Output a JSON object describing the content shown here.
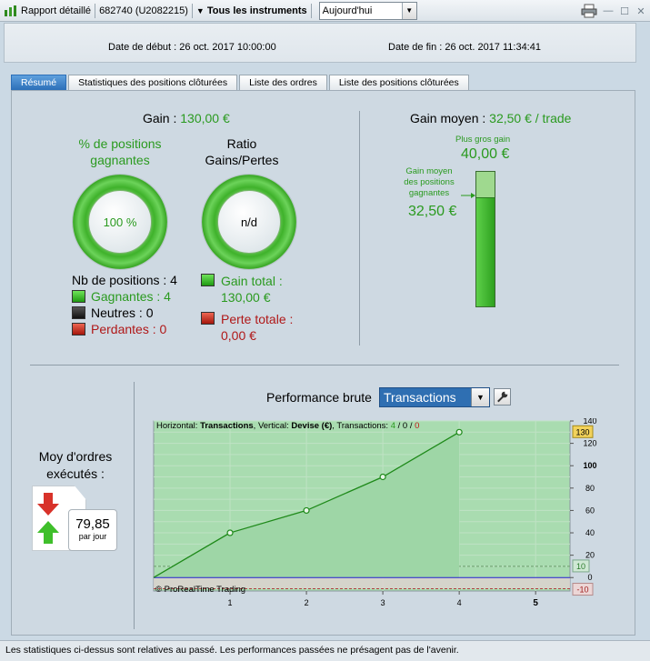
{
  "toolbar": {
    "report_label": "Rapport détaillé",
    "account": "682740 (U2082215)",
    "instruments_label": "Tous les instruments",
    "period_value": "Aujourd'hui"
  },
  "dates": {
    "start": "Date de début : 26 oct. 2017 10:00:00",
    "end": "Date de fin : 26 oct. 2017 11:34:41"
  },
  "tabs": [
    {
      "label": "Résumé",
      "active": true
    },
    {
      "label": "Statistiques des positions clôturées",
      "active": false
    },
    {
      "label": "Liste des ordres",
      "active": false
    },
    {
      "label": "Liste des positions clôturées",
      "active": false
    }
  ],
  "summary": {
    "gain_label": "Gain : ",
    "gain_value": "130,00 €",
    "winning_pct_label_1": "% de positions",
    "winning_pct_label_2": "gagnantes",
    "winning_pct_value": "100 %",
    "winning_fraction": 1.0,
    "ratio_label_1": "Ratio",
    "ratio_label_2": "Gains/Pertes",
    "ratio_value": "n/d",
    "nb_positions": "Nb de positions : 4",
    "winning": "Gagnantes : 4",
    "neutral": "Neutres : 0",
    "losing": "Perdantes : 0",
    "gain_total_label": "Gain total :",
    "gain_total_value": "130,00 €",
    "loss_total_label": "Perte totale :",
    "loss_total_value": "0,00 €"
  },
  "average": {
    "label": "Gain moyen : ",
    "value": "32,50 € / trade",
    "biggest_label": "Plus gros gain",
    "biggest_value": "40,00 €",
    "avg_winning_label_1": "Gain moyen",
    "avg_winning_label_2": "des positions",
    "avg_winning_label_3": "gagnantes",
    "avg_winning_value": "32,50 €",
    "avg_fraction": 0.8125
  },
  "orders": {
    "label_1": "Moy d'ordres",
    "label_2": "exécutés :",
    "value": "79,85",
    "unit": "par jour"
  },
  "performance": {
    "label": "Performance brute",
    "select_value": "Transactions",
    "legend_prefix": "Horizontal: ",
    "legend_h": "Transactions",
    "legend_mid": ", Vertical: ",
    "legend_v": "Devise (€)",
    "legend_tx": ", Transactions: ",
    "tx_win": "4",
    "tx_sep1": " / ",
    "tx_neutral": "0",
    "tx_sep2": " / ",
    "tx_loss": "0",
    "watermark": "© ProRealTime Trading"
  },
  "chart_data": {
    "type": "line",
    "x": [
      0,
      1,
      2,
      3,
      4
    ],
    "y": [
      0,
      40,
      60,
      90,
      130
    ],
    "xlim": [
      0,
      5.45
    ],
    "ylim": [
      -12,
      140
    ],
    "x_ticks": [
      "1",
      "2",
      "3",
      "4",
      "5"
    ],
    "y_ticks": [
      "140",
      "120",
      "100",
      "80",
      "60",
      "40",
      "20",
      "0"
    ],
    "current_value_label": "130",
    "band_labels": [
      "10",
      "-10"
    ],
    "grid": true,
    "colors": {
      "line": "#1f8a1a",
      "fill": "#a9dcb0",
      "zero": "#2222cc"
    }
  },
  "footer": {
    "text": "Les statistiques ci-dessus sont relatives au passé. Les performances passées ne présagent pas de l'avenir."
  }
}
